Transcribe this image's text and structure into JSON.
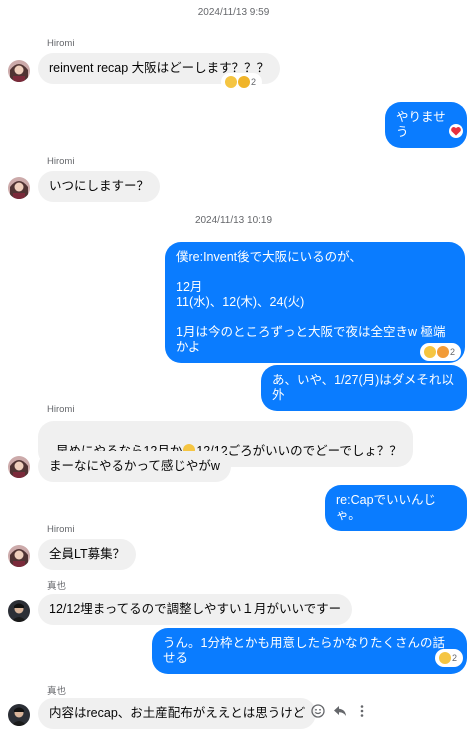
{
  "messages": {
    "ts1": "2024/11/13 9:59",
    "ts2": "2024/11/13 10:19",
    "sender_hiromi": "Hiromi",
    "sender_maya": "真也",
    "m1": "reinvent recap 大阪はどーします？？？",
    "m1_count": "2",
    "m2": "やりませう",
    "m3": "いつにしますー？",
    "m4": "僕re:Invent後で大阪にいるのが、\n\n12月\n11(水)、12(木)、24(火)\n\n1月は今のところずっと大阪で夜は全空きw 極端かよ",
    "m4_count": "2",
    "m5": "あ、いや、1/27(月)はダメそれ以外",
    "m6a": "早めにやるなら12月か",
    "m6b": "12/12ごろがいいのでどーでしょ？？",
    "m7": "まーなにやるかって感じやがw",
    "m8": "re:Capでいいんじゃ。",
    "m9": "全員LT募集？",
    "m10": "12/12埋まってるので調整しやすい１月がいいですー",
    "m11": "うん。1分枠とかも用意したらかなりたくさんの話せる",
    "m11_count": "2",
    "m12": "内容はrecap、お土産配布がええとは思うけど"
  },
  "icons": {
    "react": "smiley-icon",
    "reply": "reply-icon",
    "more": "more-icon"
  },
  "colors": {
    "outgoing": "#0a7cff",
    "incoming": "#f0f0f0",
    "meta": "#65676b"
  }
}
